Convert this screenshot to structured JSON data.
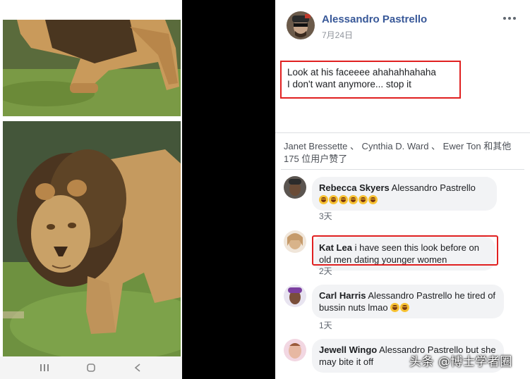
{
  "post": {
    "author": "Alessandro Pastrello",
    "date": "7月24日",
    "text_line1": "Look at his faceeee ahahahhahaha",
    "text_line2": "I don't want anymore... stop it",
    "likes_text": "Janet Bressette 、 Cynthia D. Ward 、 Ewer Ton 和其他 175 位用户赞了"
  },
  "comments": [
    {
      "name": "Rebecca Skyers",
      "text": "Alessandro Pastrello",
      "emoji_count": 6,
      "time": "3天"
    },
    {
      "name": "Kat Lea",
      "text": "i have seen this look before on old men dating younger women",
      "time": "2天"
    },
    {
      "name": "Carl Harris",
      "text": "Alessandro Pastrello he tired of bussin nuts lmao",
      "emoji_count": 2,
      "time": "1天"
    },
    {
      "name": "Jewell Wingo",
      "text": "Alessandro Pastrello but she may bite it off"
    }
  ],
  "watermark": "头条 @博士学者圈",
  "colors": {
    "accent_link": "#385898",
    "highlight_box": "#e02020",
    "bubble": "#f2f3f5"
  }
}
